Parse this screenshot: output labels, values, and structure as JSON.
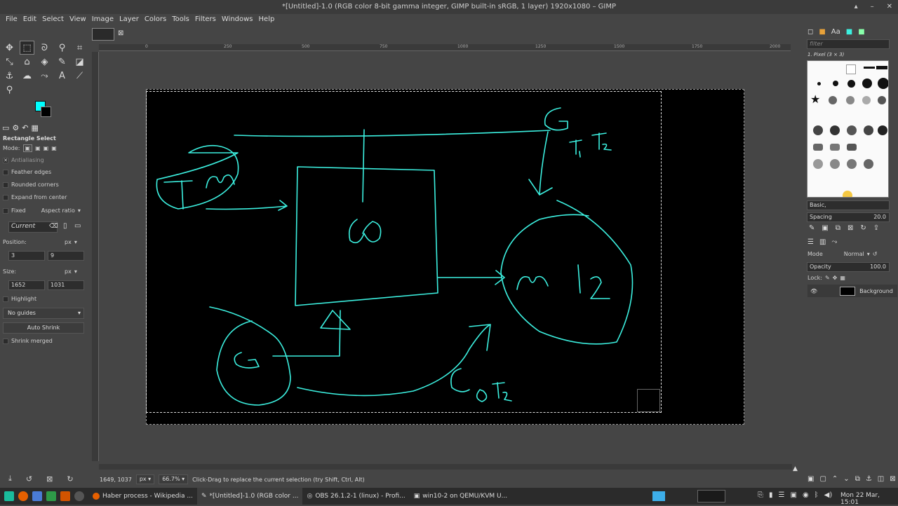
{
  "window": {
    "title": "*[Untitled]-1.0 (RGB color 8-bit gamma integer, GIMP built-in sRGB, 1 layer) 1920x1080 – GIMP",
    "controls": [
      "▴",
      "–",
      "✕"
    ]
  },
  "menu": [
    "File",
    "Edit",
    "Select",
    "View",
    "Image",
    "Layer",
    "Colors",
    "Tools",
    "Filters",
    "Windows",
    "Help"
  ],
  "colors": {
    "foreground": "#00ffff",
    "background": "#000000",
    "stroke": "#3cf0e0"
  },
  "tool_options": {
    "title": "Rectangle Select",
    "mode_label": "Mode:",
    "antialiasing": "Antialiasing",
    "feather": "Feather edges",
    "rounded": "Rounded corners",
    "expand": "Expand from center",
    "fixed": "Fixed",
    "aspect": "Aspect ratio",
    "current": "Current",
    "position_label": "Position:",
    "pos_unit": "px",
    "pos_x": "3",
    "pos_y": "9",
    "size_label": "Size:",
    "size_unit": "px",
    "size_w": "1652",
    "size_h": "1031",
    "highlight": "Highlight",
    "guides": "No guides",
    "auto_shrink": "Auto Shrink",
    "shrink_merged": "Shrink merged"
  },
  "ruler": {
    "ticks": [
      "0",
      "250",
      "500",
      "750",
      "1000",
      "1250",
      "1500",
      "1750",
      "2000"
    ]
  },
  "status": {
    "coords": "1649, 1037",
    "unit": "px",
    "zoom": "66.7%",
    "message": "Click-Drag to replace the current selection (try Shift, Ctrl, Alt)"
  },
  "brushes": {
    "filter_placeholder": "filter",
    "current": "1. Pixel (3 × 3)",
    "preset": "Basic,",
    "spacing_label": "Spacing",
    "spacing_value": "20.0"
  },
  "layers": {
    "mode_label": "Mode",
    "mode_value": "Normal",
    "opacity_label": "Opacity",
    "opacity_value": "100.0",
    "lock_label": "Lock:",
    "layer_name": "Background"
  },
  "drawing_labels": [
    "T",
    "m",
    "G",
    "T₁ T₂",
    "m I₂",
    "G",
    "G Q T₂"
  ],
  "taskbar": {
    "tasks": [
      "Haber process - Wikipedia ...",
      "*[Untitled]-1.0 (RGB color ...",
      "OBS 26.1.2-1 (linux) - Profi...",
      "win10-2 on QEMU/KVM U..."
    ],
    "clock": "Mon 22 Mar, 15:01"
  }
}
